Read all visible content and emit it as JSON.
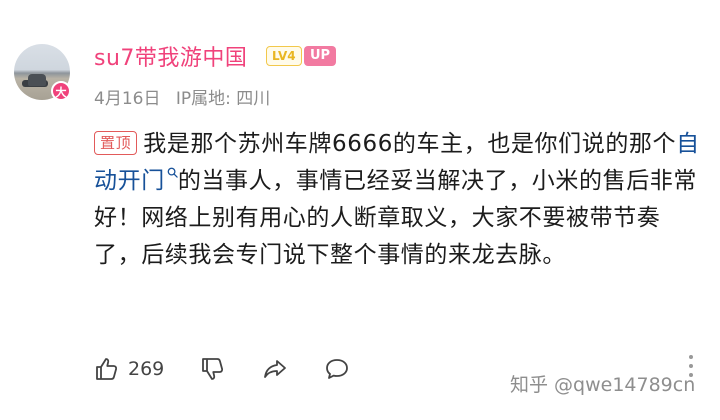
{
  "comment": {
    "avatar_badge": "大",
    "username": "su7带我游中国",
    "level_badge": "LV4",
    "up_badge": "UP",
    "date": "4月16日",
    "ip_location": "IP属地: 四川",
    "pin_label": "置顶",
    "text_before_link": "我是那个苏州车牌6666的车主，也是你们说的那个",
    "link_text": "自动开门",
    "text_after_link": "的当事人，事情已经妥当解决了，小米的售后非常好！网络上别有用心的人断章取义，大家不要被带节奏了，后续我会专门说下整个事情的来龙去脉。",
    "like_count": "269"
  },
  "watermark": "知乎 @qwe14789cn",
  "colors": {
    "username": "#f0427b",
    "link": "#175199",
    "pin": "#e25a5a",
    "meta": "#8c8c8c"
  },
  "icons": [
    "thumbs-up-icon",
    "thumbs-down-icon",
    "share-icon",
    "reply-icon",
    "more-icon",
    "search-icon"
  ]
}
